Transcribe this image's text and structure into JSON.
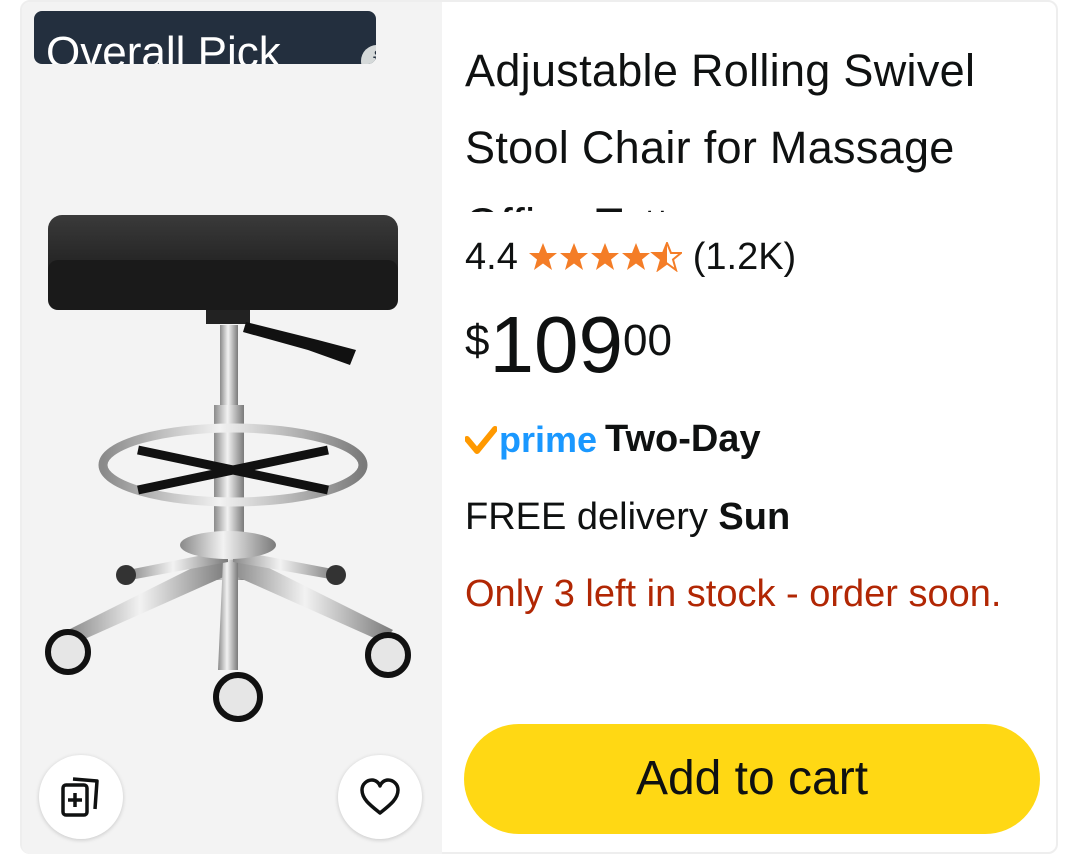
{
  "badge": {
    "label": "Overall Pick",
    "info_icon": "info-icon"
  },
  "product": {
    "title": "Adjustable Rolling Swivel Stool Chair for Massage Office Tattoo",
    "rating": {
      "value": "4.4",
      "stars": 4.5,
      "count": "(1.2K)"
    },
    "price": {
      "symbol": "$",
      "whole": "109",
      "fraction": "00"
    },
    "shipping": {
      "prime_label": "prime",
      "speed": "Two-Day",
      "delivery_prefix": "FREE delivery",
      "delivery_day": "Sun"
    },
    "stock_message": "Only 3 left in stock - order soon."
  },
  "actions": {
    "add_to_cart": "Add to cart",
    "compare_icon": "compare-add-icon",
    "wishlist_icon": "heart-icon"
  },
  "colors": {
    "badge_bg": "#232f3e",
    "star": "#f47d27",
    "prime_blue": "#1a98ff",
    "prime_check": "#ff9900",
    "stock_red": "#b12704",
    "cart_button": "#ffd814"
  }
}
